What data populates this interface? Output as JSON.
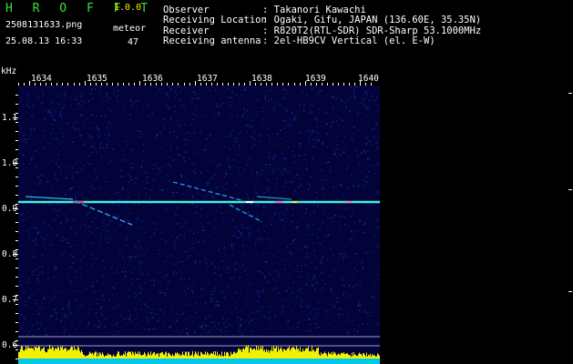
{
  "header": {
    "app_title": "H R O F F T",
    "version": "1.0.0",
    "filename": "2508131633.png",
    "datetime": "25.08.13 16:33",
    "counter_label": "meteor",
    "counter_value": "47"
  },
  "info": [
    {
      "label": "Observer",
      "value": ": Takanori Kawachi"
    },
    {
      "label": "Receiving Location",
      "value": ": Ogaki, Gifu, JAPAN (136.60E, 35.35N)"
    },
    {
      "label": "Receiver",
      "value": ": R820T2(RTL-SDR) SDR-Sharp 53.1000MHz"
    },
    {
      "label": "Receiving antenna",
      "value": ": 2el-HB9CV Vertical (el. E-W)"
    }
  ],
  "axes": {
    "y_unit": "kHz",
    "x_ticks": [
      "1634",
      "1635",
      "1636",
      "1637",
      "1638",
      "1639",
      "1640"
    ],
    "y_ticks": [
      "1.1",
      "1.0",
      "0.9",
      "0.8",
      "0.7",
      "0.6"
    ]
  },
  "colors": {
    "title": "#3ce03c",
    "version": "#f0f000",
    "spectrogram_bg": "#03033a",
    "carrier": "#2ef0d0",
    "signal_bar_cyan": "#00c8e6",
    "signal_bar_yellow": "#f2f200"
  }
}
